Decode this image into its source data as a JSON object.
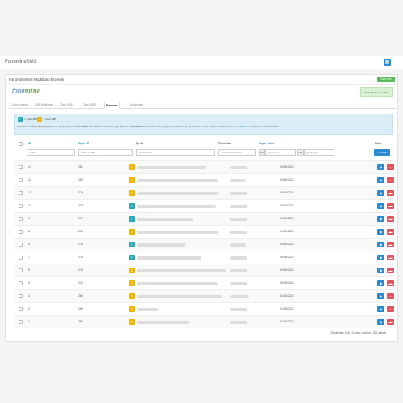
{
  "window": {
    "title": "FonomineSMS"
  },
  "panel": {
    "title": "FonomineSMS Modülünü Düzenle",
    "back_button": "Geri dön"
  },
  "logo": {
    "part1": "fono",
    "part2": "mine"
  },
  "status_box": "SMS Bakiyeniz : 1801",
  "tabs": [
    "Genel Ayarlar",
    "SMS Bildirimleri",
    "Özel SMS",
    "Toplu SMS",
    "Raporlar",
    "Kullanıcılar"
  ],
  "active_tab": 4,
  "legend": {
    "badge_toplu": "T",
    "label_toplu": "= Toplu SMS",
    "badge_ozel": "Ö",
    "label_ozel": "= Özel SMS"
  },
  "info_text": "Burada hem Toplu SMS (Siparişler ve Gruplar) hem de Özel SMS (tekil bildirim) raporlarını görebilirsiniz. SMS Bildirimleri sekmesinden yapılan gönderimler de aynı listede yer alır. Rapor detaylarına",
  "info_link": "FonomineSMS panel",
  "info_text2": "üzerinden ulaşabilirsiniz.",
  "columns": {
    "id": "ID",
    "report_id": "Rapor ID",
    "content": "İçerik",
    "numbers": "Telefonlar",
    "date": "Rapor Tarihi",
    "actions": "İşlem"
  },
  "filters": {
    "id": "ID ara...",
    "report_id": "Rapor ID ara...",
    "content": "İçerikte ara...",
    "numbers": "Numara-Birebi ara...",
    "from_label": "Dan",
    "from": "gg.aa.yyyy",
    "to_label": "Dek",
    "to": "gg.aa.yyyy",
    "button": "Filtrele"
  },
  "rows": [
    {
      "id": "13",
      "report_id": "281",
      "type": "Ö",
      "date": "09/06/2023"
    },
    {
      "id": "12",
      "report_id": "280",
      "type": "Ö",
      "date": "09/06/2023"
    },
    {
      "id": "11",
      "report_id": "279",
      "type": "Ö",
      "date": "09/06/2023"
    },
    {
      "id": "10",
      "report_id": "278",
      "type": "T",
      "date": "09/06/2023"
    },
    {
      "id": "9",
      "report_id": "277",
      "type": "T",
      "date": "09/06/2023"
    },
    {
      "id": "8",
      "report_id": "276",
      "type": "Ö",
      "date": "09/06/2023"
    },
    {
      "id": "8",
      "report_id": "275",
      "type": "T",
      "date": "09/06/2023"
    },
    {
      "id": "7",
      "report_id": "275",
      "type": "T",
      "date": "09/06/2023"
    },
    {
      "id": "5",
      "report_id": "273",
      "type": "Ö",
      "date": "09/06/2023"
    },
    {
      "id": "4",
      "report_id": "272",
      "type": "Ö",
      "date": "09/06/2023"
    },
    {
      "id": "3",
      "report_id": "266",
      "type": "Ö",
      "date": "01/06/2023"
    },
    {
      "id": "2",
      "report_id": "265",
      "type": "Ö",
      "date": "01/06/2023"
    },
    {
      "id": "1",
      "report_id": "265",
      "type": "Ö",
      "date": "01/06/2023"
    }
  ],
  "footer": "Gösterilen 1 ile 13 arası, toplam 1321 kayıttı",
  "icons": {
    "view": "eye-icon",
    "delete": "trash-icon",
    "search": "search-icon"
  },
  "colors": {
    "toplu": "#2aa6b8",
    "ozel": "#f0b400",
    "view": "#2a8bd0",
    "delete": "#e0535b",
    "accent": "#2a8bb8"
  }
}
